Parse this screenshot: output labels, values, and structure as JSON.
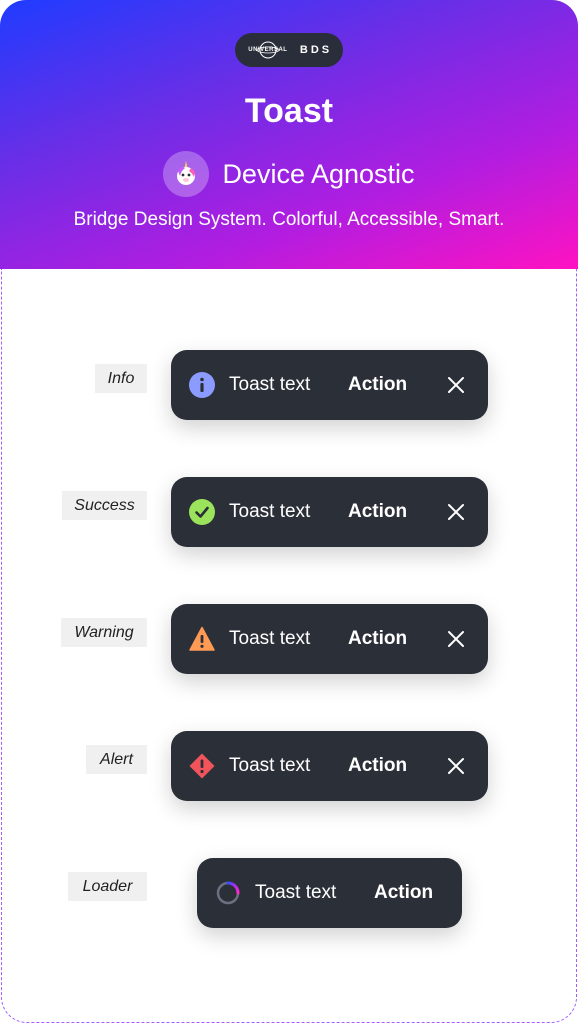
{
  "header": {
    "brand_logo_text": "UNIVERSAL",
    "brand_badge": "BDS",
    "title": "Toast",
    "subtitle": "Device Agnostic",
    "tagline": "Bridge Design System. Colorful, Accessible, Smart."
  },
  "toasts": [
    {
      "label": "Info",
      "text": "Toast text",
      "action": "Action",
      "icon": "info-icon",
      "color": "#8c9bff",
      "dismissible": true
    },
    {
      "label": "Success",
      "text": "Toast text",
      "action": "Action",
      "icon": "check-icon",
      "color": "#9be35a",
      "dismissible": true
    },
    {
      "label": "Warning",
      "text": "Toast text",
      "action": "Action",
      "icon": "warning-icon",
      "color": "#ff9a55",
      "dismissible": true
    },
    {
      "label": "Alert",
      "text": "Toast text",
      "action": "Action",
      "icon": "alert-icon",
      "color": "#f2545b",
      "dismissible": true
    },
    {
      "label": "Loader",
      "text": "Toast text",
      "action": "Action",
      "icon": "loader-icon",
      "color": "#8a3ffc",
      "dismissible": false
    }
  ],
  "colors": {
    "gradient_start": "#1f3cff",
    "gradient_end": "#ff12c2",
    "toast_background": "#2b2f38",
    "frame_dash": "#a35cff"
  }
}
